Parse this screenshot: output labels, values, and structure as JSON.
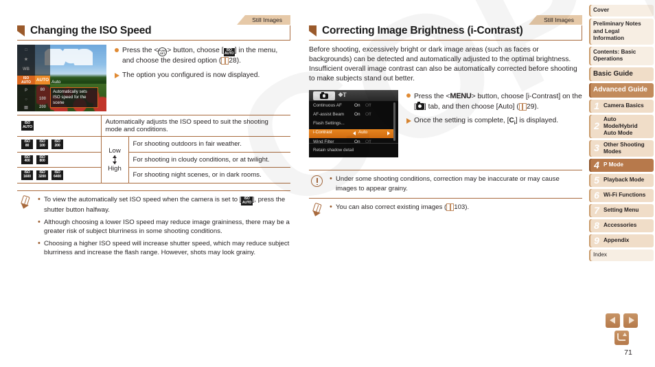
{
  "watermark": {
    "text": "COPY"
  },
  "page": {
    "number": "71"
  },
  "left": {
    "tab_label": "Still Images",
    "heading": "Changing the ISO Speed",
    "figure": {
      "name": "iso-selection-screen",
      "left_items": [
        "□",
        "★",
        "WB",
        "ISO",
        "P",
        "⊙",
        "▣"
      ],
      "selected_left": "ISO\nAUTO",
      "options": [
        "AUTO",
        "80",
        "100",
        "200"
      ],
      "selected_option": "AUTO",
      "option_label": "Auto",
      "description": "Automatically sets ISO speed for the scene"
    },
    "steps": [
      {
        "marker": "dot",
        "before": "Press the <",
        "kbd": "FUNC/SET",
        "middle": "> button, choose [",
        "badge_top": "ISO",
        "badge_bottom": "AUTO",
        "after": "] in the menu, and choose the desired option (",
        "ref": "28",
        "end": ")."
      },
      {
        "marker": "triangle",
        "text": "The option you configured is now displayed."
      }
    ],
    "table": {
      "rows": [
        {
          "icons": [
            {
              "top": "ISO",
              "bottom": "AUTO"
            }
          ],
          "level": "",
          "level_span": true,
          "desc": "Automatically adjusts the ISO speed to suit the shooting mode and conditions."
        },
        {
          "icons": [
            {
              "top": "ISO",
              "bottom": "80"
            },
            {
              "top": "ISO",
              "bottom": "100"
            },
            {
              "top": "ISO",
              "bottom": "200"
            }
          ],
          "level": "Low",
          "desc": "For shooting outdoors in fair weather."
        },
        {
          "icons": [
            {
              "top": "ISO",
              "bottom": "400"
            },
            {
              "top": "ISO",
              "bottom": "800"
            }
          ],
          "level": "arrow",
          "desc": "For shooting in cloudy conditions, or at twilight."
        },
        {
          "icons": [
            {
              "top": "ISO",
              "bottom": "1600"
            },
            {
              "top": "ISO",
              "bottom": "3200"
            },
            {
              "top": "ISO",
              "bottom": "6400"
            }
          ],
          "level": "High",
          "desc": "For shooting night scenes, or in dark rooms."
        }
      ]
    },
    "note": {
      "icon": "pencil-icon",
      "items": [
        {
          "pre": "To view the automatically set ISO speed when the camera is set to [",
          "badge_top": "ISO",
          "badge_bottom": "AUTO",
          "post": "], press the shutter button halfway."
        },
        {
          "pre": "Although choosing a lower ISO speed may reduce image graininess, there may be a greater risk of subject blurriness in some shooting conditions.",
          "post": ""
        },
        {
          "pre": "Choosing a higher ISO speed will increase shutter speed, which may reduce subject blurriness and increase the flash range. However, shots may look grainy.",
          "post": ""
        }
      ]
    }
  },
  "right": {
    "tab_label": "Still Images",
    "heading": "Correcting Image Brightness (i-Contrast)",
    "intro": "Before shooting, excessively bright or dark image areas (such as faces or backgrounds) can be detected and automatically adjusted to the optimal brightness. Insufficient overall image contrast can also be automatically corrected before shooting to make subjects stand out better.",
    "figure": {
      "name": "shooting-menu-screen",
      "tab_shoot": "camera-tab-icon",
      "tab_setup": "wrench-tab-icon",
      "rows": [
        {
          "name": "Continuous AF",
          "v1": "On",
          "v2": "Off",
          "selected": false
        },
        {
          "name": "AF-assist Beam",
          "v1": "On",
          "v2": "Off",
          "selected": false
        },
        {
          "name": "Flash Settings...",
          "v1": "",
          "v2": "",
          "selected": false
        },
        {
          "name": "i-Contrast",
          "v1": "Auto",
          "v2": "",
          "selected": true
        },
        {
          "name": "Wind Filter",
          "v1": "On",
          "v2": "Off",
          "selected": false
        }
      ],
      "footer": "Retain shadow detail"
    },
    "steps": [
      {
        "marker": "dot",
        "p1": "Press the <",
        "kbd": "MENU",
        "p2": "> button, choose [i-Contrast] on the [",
        "cam": "camera-icon",
        "p3": "] tab, and then choose [Auto] (",
        "ref": "29",
        "p4": ")."
      },
      {
        "marker": "triangle",
        "p1": "Once the setting is complete, [",
        "badge": "Ci",
        "p2": "] is displayed."
      }
    ],
    "caution": {
      "icon": "exclamation-icon",
      "items": [
        "Under some shooting conditions, correction may be inaccurate or may cause images to appear grainy."
      ]
    },
    "note": {
      "icon": "pencil-icon",
      "pre": "You can also correct existing images (",
      "ref": "103",
      "post": ")."
    }
  },
  "sidebar": {
    "items": [
      {
        "label": "Cover",
        "type": "plain",
        "num": ""
      },
      {
        "label": "Preliminary Notes and Legal Information",
        "type": "plain",
        "num": ""
      },
      {
        "label": "Contents: Basic Operations",
        "type": "plain",
        "num": ""
      },
      {
        "label": "Basic Guide",
        "type": "large",
        "num": ""
      },
      {
        "label": "Advanced Guide",
        "type": "advanced",
        "num": ""
      },
      {
        "label": "Camera Basics",
        "type": "num",
        "num": "1"
      },
      {
        "label": "Auto Mode/Hybrid Auto Mode",
        "type": "num",
        "num": "2"
      },
      {
        "label": "Other Shooting Modes",
        "type": "num",
        "num": "3"
      },
      {
        "label": "P Mode",
        "type": "num-active",
        "num": "4"
      },
      {
        "label": "Playback Mode",
        "type": "num",
        "num": "5"
      },
      {
        "label": "Wi-Fi Functions",
        "type": "num",
        "num": "6"
      },
      {
        "label": "Setting Menu",
        "type": "num",
        "num": "7"
      },
      {
        "label": "Accessories",
        "type": "num",
        "num": "8"
      },
      {
        "label": "Appendix",
        "type": "num",
        "num": "9"
      },
      {
        "label": "Index",
        "type": "plain",
        "num": ""
      }
    ]
  },
  "nav": {
    "prev": "previous-page-arrow",
    "next": "next-page-arrow",
    "back": "back-button"
  },
  "colors": {
    "accent_brown": "#a86a3d",
    "accent_orange": "#e08a33",
    "tab_bg": "#e6c9a8",
    "sidebar_bg": "#f0ddc8",
    "sidebar_active": "#b7794b"
  }
}
